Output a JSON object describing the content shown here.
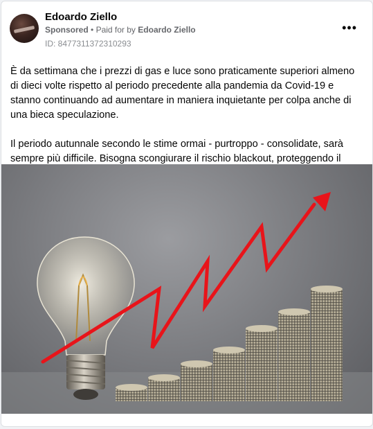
{
  "post": {
    "author": "Edoardo Ziello",
    "sponsored_label": "Sponsored",
    "separator": "•",
    "paid_for_by_prefix": "Paid for by",
    "payer": "Edoardo Ziello",
    "ad_id": "ID: 8477311372310293",
    "more_icon": "more-horizontal-icon",
    "paragraph_1": "È da settimana che i prezzi di gas e luce sono praticamente superiori almeno di dieci volte rispetto al periodo precedente alla pandemia da Covid-19 e stanno continuando ad aumentare in maniera inquietante per colpa anche di una bieca speculazione.",
    "paragraph_2": "Il periodo autunnale secondo le stime ormai - purtroppo - consolidate, sarà sempre più difficile. Bisogna scongiurare il rischio blackout, proteggendo il potere…"
  },
  "image": {
    "subject": "light bulb with rising coin stacks and red upward arrow",
    "arrow_color": "#e8141a"
  }
}
